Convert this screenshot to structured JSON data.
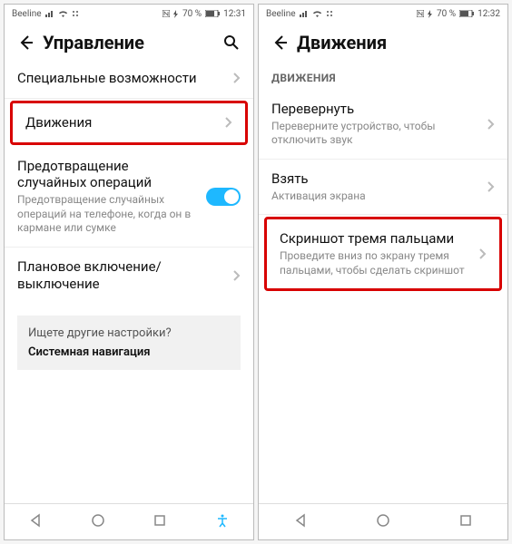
{
  "left": {
    "status": {
      "carrier": "Beeline",
      "battery": "70 %",
      "time": "12:31"
    },
    "header": {
      "title": "Управление"
    },
    "rows": {
      "accessibility": "Специальные возможности",
      "motions": "Движения",
      "prevent": {
        "title": "Предотвращение случайных операций",
        "desc": "Предотвращение случайных операций на телефоне, когда он в кармане или сумке"
      },
      "scheduled": "Плановое включение/выключение"
    },
    "promo": {
      "question": "Ищете другие настройки?",
      "link": "Системная навигация"
    }
  },
  "right": {
    "status": {
      "carrier": "Beeline",
      "battery": "70 %",
      "time": "12:32"
    },
    "header": {
      "title": "Движения"
    },
    "section": "ДВИЖЕНИЯ",
    "rows": {
      "flip": {
        "title": "Перевернуть",
        "desc": "Переверните устройство, чтобы отключить звук"
      },
      "pickup": {
        "title": "Взять",
        "desc": "Активация экрана"
      },
      "three": {
        "title": "Скриншот тремя пальцами",
        "desc": "Проведите вниз по экрану тремя пальцами, чтобы сделать скриншот"
      }
    }
  }
}
